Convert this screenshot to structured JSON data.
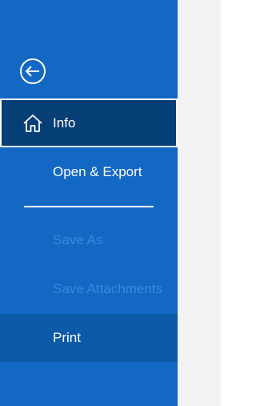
{
  "colors": {
    "nav_background": "#1368c4",
    "selected_background": "#063e76",
    "hover_background": "#0c5aa7",
    "disabled_text": "#3a87da",
    "text": "#ffffff",
    "content_background": "#f3f3f3"
  },
  "back": {
    "icon": "back-arrow-icon"
  },
  "nav": {
    "info": {
      "label": "Info",
      "icon": "home-icon",
      "state": "selected"
    },
    "open_export": {
      "label": "Open & Export"
    },
    "save_as": {
      "label": "Save As",
      "state": "disabled"
    },
    "save_attachments": {
      "label": "Save Attachments",
      "state": "disabled"
    },
    "print": {
      "label": "Print",
      "state": "hover"
    }
  }
}
